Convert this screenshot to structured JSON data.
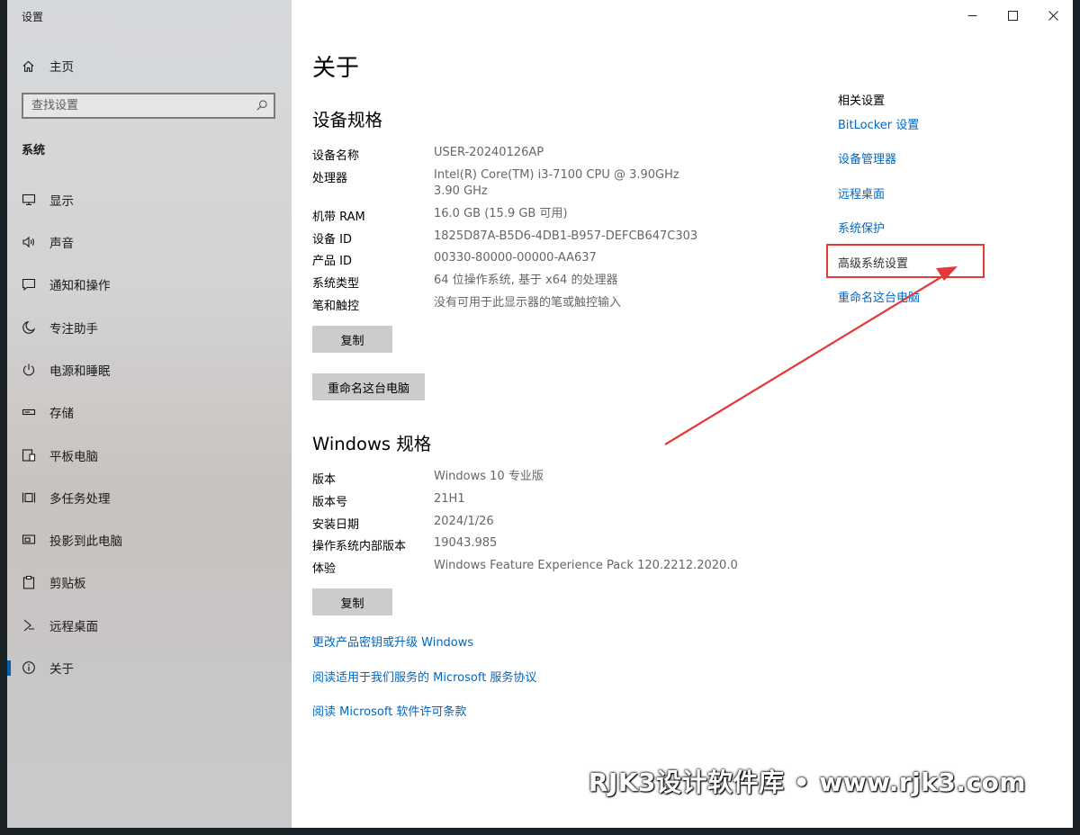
{
  "window": {
    "app_title": "设置",
    "controls": {
      "minimize": "minimize-icon",
      "maximize": "maximize-icon",
      "close": "close-icon"
    }
  },
  "sidebar": {
    "home_label": "主页",
    "search_placeholder": "查找设置",
    "section_title": "系统",
    "items": [
      {
        "label": "显示",
        "icon": "monitor-icon"
      },
      {
        "label": "声音",
        "icon": "speaker-icon"
      },
      {
        "label": "通知和操作",
        "icon": "notification-icon"
      },
      {
        "label": "专注助手",
        "icon": "moon-icon"
      },
      {
        "label": "电源和睡眠",
        "icon": "power-icon"
      },
      {
        "label": "存储",
        "icon": "storage-icon"
      },
      {
        "label": "平板电脑",
        "icon": "tablet-icon"
      },
      {
        "label": "多任务处理",
        "icon": "multitask-icon"
      },
      {
        "label": "投影到此电脑",
        "icon": "project-icon"
      },
      {
        "label": "剪贴板",
        "icon": "clipboard-icon"
      },
      {
        "label": "远程桌面",
        "icon": "remote-desktop-icon"
      },
      {
        "label": "关于",
        "icon": "info-icon",
        "active": true
      }
    ],
    "accent_color": "#0063b1"
  },
  "main": {
    "page_title": "关于",
    "device_spec_title": "设备规格",
    "device_specs": [
      {
        "label": "设备名称",
        "value": "USER-20240126AP"
      },
      {
        "label": "处理器",
        "value": "Intel(R) Core(TM) i3-7100 CPU @ 3.90GHz   3.90 GHz"
      },
      {
        "label": "机带 RAM",
        "value": "16.0 GB (15.9 GB 可用)"
      },
      {
        "label": "设备 ID",
        "value": "1825D87A-B5D6-4DB1-B957-DEFCB647C303"
      },
      {
        "label": "产品 ID",
        "value": "00330-80000-00000-AA637"
      },
      {
        "label": "系统类型",
        "value": "64 位操作系统, 基于 x64 的处理器"
      },
      {
        "label": "笔和触控",
        "value": "没有可用于此显示器的笔或触控输入"
      }
    ],
    "copy_button": "复制",
    "rename_button": "重命名这台电脑",
    "windows_spec_title": "Windows 规格",
    "windows_specs": [
      {
        "label": "版本",
        "value": "Windows 10 专业版"
      },
      {
        "label": "版本号",
        "value": "21H1"
      },
      {
        "label": "安装日期",
        "value": "2024/1/26"
      },
      {
        "label": "操作系统内部版本",
        "value": "19043.985"
      },
      {
        "label": "体验",
        "value": "Windows Feature Experience Pack 120.2212.2020.0"
      }
    ],
    "copy_button_2": "复制",
    "links": [
      "更改产品密钥或升级 Windows",
      "阅读适用于我们服务的 Microsoft 服务协议",
      "阅读 Microsoft 软件许可条款"
    ]
  },
  "related": {
    "title": "相关设置",
    "links": [
      "BitLocker 设置",
      "设备管理器",
      "远程桌面",
      "系统保护",
      "高级系统设置",
      "重命名这台电脑"
    ],
    "highlight_color": "#e53838",
    "link_color": "#0067c0"
  },
  "watermark": "RJK3设计软件库 • www.rjk3.com"
}
